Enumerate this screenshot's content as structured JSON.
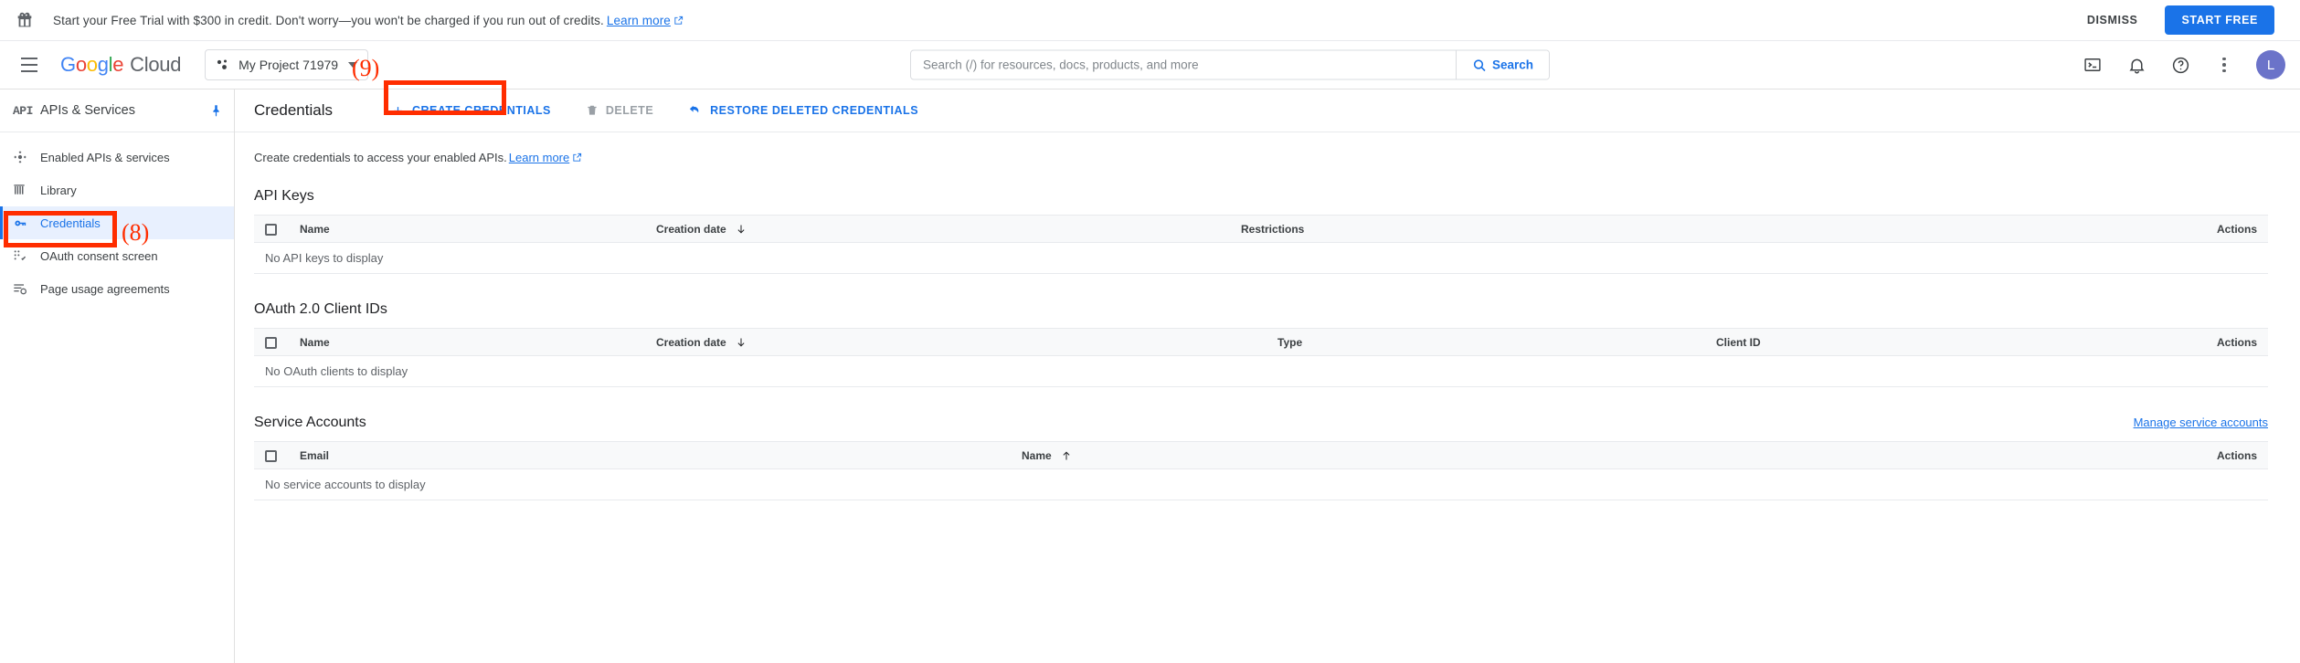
{
  "promo": {
    "icon": "gift-icon",
    "text": "Start your Free Trial with $300 in credit. Don't worry—you won't be charged if you run out of credits.",
    "link_label": "Learn more",
    "dismiss_label": "DISMISS",
    "start_free_label": "START FREE",
    "accent_color": "#1a73e8"
  },
  "header": {
    "menu_icon": "hamburger-menu-icon",
    "logo_google": "Google",
    "logo_cloud": "Cloud",
    "project": {
      "name": "My Project 71979",
      "icon": "project-dots-icon",
      "caret": "chevron-down-icon"
    },
    "search": {
      "placeholder": "Search (/) for resources, docs, products, and more",
      "value": "",
      "button_label": "Search",
      "icon": "search-icon"
    },
    "icons": [
      {
        "name": "cloud-shell-icon",
        "title": "Activate Cloud Shell"
      },
      {
        "name": "notifications-bell-icon",
        "title": "Notifications"
      },
      {
        "name": "help-question-icon",
        "title": "Help"
      },
      {
        "name": "more-options-kebab-icon",
        "title": "More options"
      }
    ],
    "avatar_initial": "L",
    "avatar_color": "#6b73c9"
  },
  "sidebar": {
    "product_glyph": "API",
    "title": "APIs & Services",
    "pin_icon": "pin-icon",
    "items": [
      {
        "label": "Enabled APIs & services",
        "icon": "enabled-apis-icon",
        "active": false
      },
      {
        "label": "Library",
        "icon": "library-icon",
        "active": false
      },
      {
        "label": "Credentials",
        "icon": "key-icon",
        "active": true
      },
      {
        "label": "OAuth consent screen",
        "icon": "oauth-consent-icon",
        "active": false
      },
      {
        "label": "Page usage agreements",
        "icon": "page-usage-agreements-icon",
        "active": false
      }
    ]
  },
  "main": {
    "page_title": "Credentials",
    "toolbar": [
      {
        "label": "CREATE CREDENTIALS",
        "icon": "plus-icon",
        "disabled": false
      },
      {
        "label": "DELETE",
        "icon": "trash-icon",
        "disabled": true
      },
      {
        "label": "RESTORE DELETED CREDENTIALS",
        "icon": "restore-undo-icon",
        "disabled": false
      }
    ],
    "description": "Create credentials to access your enabled APIs.",
    "description_link": "Learn more",
    "sections": [
      {
        "title": "API Keys",
        "columns": [
          {
            "label": "",
            "type": "checkbox"
          },
          {
            "label": "Name",
            "sort": "none"
          },
          {
            "label": "Creation date",
            "sort": "desc"
          },
          {
            "label": "Restrictions",
            "sort": "none"
          },
          {
            "label": "Actions",
            "align": "right"
          }
        ],
        "empty_message": "No API keys to display",
        "rows": []
      },
      {
        "title": "OAuth 2.0 Client IDs",
        "columns": [
          {
            "label": "",
            "type": "checkbox"
          },
          {
            "label": "Name",
            "sort": "none"
          },
          {
            "label": "Creation date",
            "sort": "desc"
          },
          {
            "label": "Type",
            "sort": "none"
          },
          {
            "label": "Client ID",
            "sort": "none"
          },
          {
            "label": "Actions",
            "align": "right"
          }
        ],
        "empty_message": "No OAuth clients to display",
        "rows": []
      },
      {
        "title": "Service Accounts",
        "side_link": "Manage service accounts",
        "columns": [
          {
            "label": "",
            "type": "checkbox"
          },
          {
            "label": "Email",
            "sort": "none"
          },
          {
            "label": "Name",
            "sort": "asc"
          },
          {
            "label": "Actions",
            "align": "right"
          }
        ],
        "empty_message": "No service accounts to display",
        "rows": []
      }
    ]
  },
  "annotations": {
    "color": "#ff2d00",
    "markers": [
      {
        "id": "8",
        "label": "(8)",
        "targets": "sidebar-item-credentials"
      },
      {
        "id": "9",
        "label": "(9)",
        "targets": "create-credentials-button"
      }
    ]
  }
}
